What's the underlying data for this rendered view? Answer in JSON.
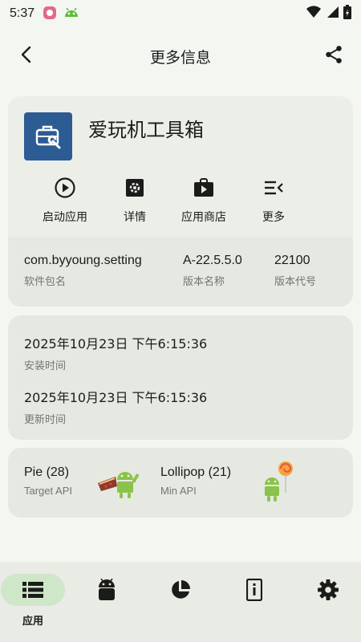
{
  "status_bar": {
    "time": "5:37",
    "icons": [
      "notification-app-icon",
      "android-bug-icon"
    ],
    "right_icons": [
      "wifi-icon",
      "signal-icon",
      "battery-charging-icon"
    ]
  },
  "app_bar": {
    "title": "更多信息",
    "back_icon": "arrow-back-icon",
    "share_icon": "share-icon"
  },
  "app": {
    "name": "爱玩机工具箱",
    "icon": "toolbox-icon",
    "icon_color": "#2d5b93",
    "actions": [
      {
        "label": "启动应用",
        "icon": "play-circle-icon"
      },
      {
        "label": "详情",
        "icon": "settings-box-icon"
      },
      {
        "label": "应用商店",
        "icon": "shop-bag-icon"
      },
      {
        "label": "更多",
        "icon": "menu-open-icon"
      }
    ],
    "package": {
      "value": "com.byyoung.setting",
      "label": "软件包名"
    },
    "version_name": {
      "value": "A-22.5.5.0",
      "label": "版本名称"
    },
    "version_code": {
      "value": "22100",
      "label": "版本代号"
    }
  },
  "times": {
    "install": {
      "value": "2025年10月23日 下午6:15:36",
      "label": "安装时间"
    },
    "update": {
      "value": "2025年10月23日 下午6:15:36",
      "label": "更新时间"
    }
  },
  "api": {
    "target": {
      "value": "Pie (28)",
      "label": "Target API",
      "mascot": "android-pie-mascot"
    },
    "min": {
      "value": "Lollipop (21)",
      "label": "Min API",
      "mascot": "android-lollipop-mascot"
    }
  },
  "bottom_nav": {
    "items": [
      {
        "label": "应用",
        "icon": "list-icon",
        "active": true
      },
      {
        "label": "",
        "icon": "android-head-icon",
        "active": false
      },
      {
        "label": "",
        "icon": "pie-chart-icon",
        "active": false
      },
      {
        "label": "",
        "icon": "info-device-icon",
        "active": false
      },
      {
        "label": "",
        "icon": "settings-gear-icon",
        "active": false
      }
    ]
  },
  "colors": {
    "background": "#f4f6f1",
    "card": "#e6e8e2",
    "nav_active": "#cfe6c8",
    "app_icon": "#2d5b93",
    "android_green": "#8bc34a"
  }
}
